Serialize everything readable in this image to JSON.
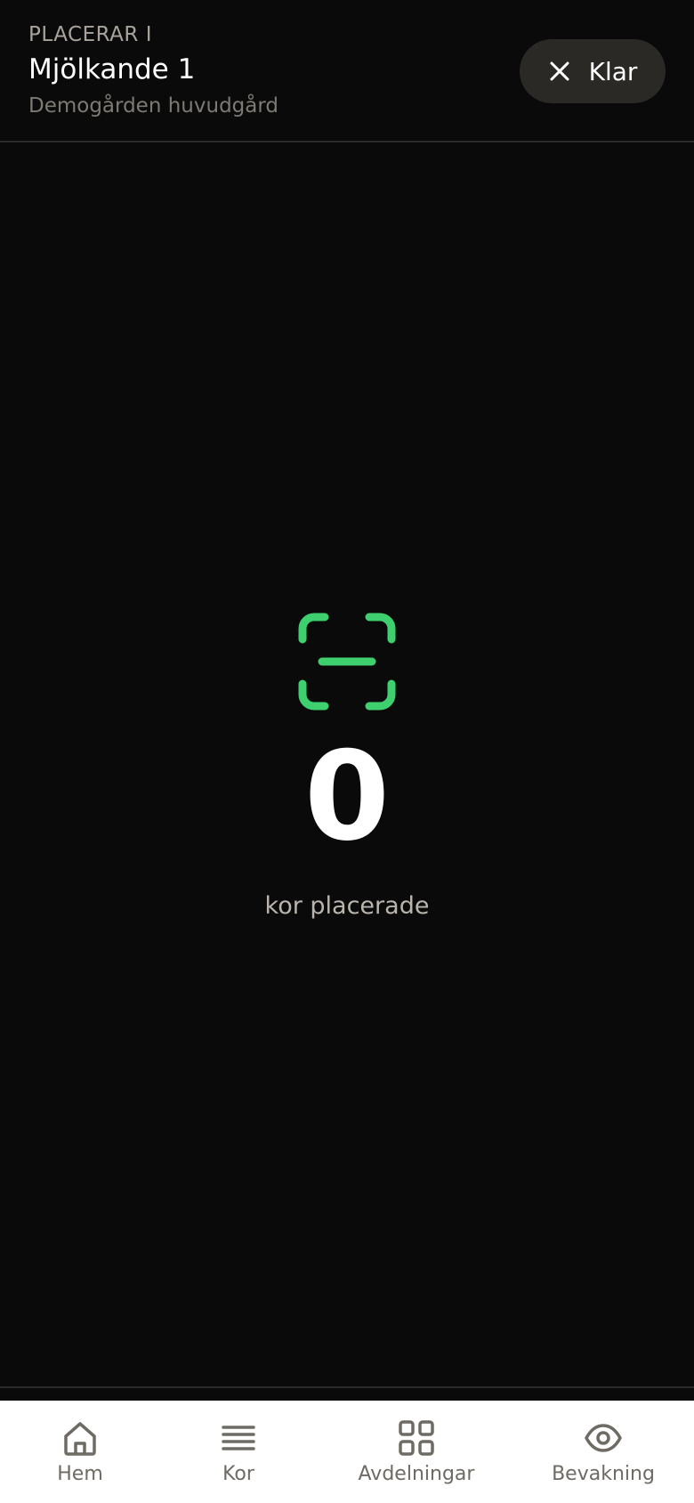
{
  "header": {
    "mode_label": "PLACERAR I",
    "title": "Mjölkande 1",
    "subtitle": "Demogården huvudgård",
    "done_button": {
      "label": "Klar",
      "icon": "close-icon"
    }
  },
  "scanner": {
    "icon": "scan-icon",
    "count": "0",
    "count_label": "kor placerade",
    "accent_color": "#3ecf6e"
  },
  "bottom_nav": {
    "items": [
      {
        "label": "Hem",
        "icon": "home-icon"
      },
      {
        "label": "Kor",
        "icon": "list-icon"
      },
      {
        "label": "Avdelningar",
        "icon": "grid-icon"
      },
      {
        "label": "Bevakning",
        "icon": "eye-icon"
      }
    ]
  },
  "colors": {
    "background": "#0a0a0a",
    "button_bg": "#2b2926",
    "nav_bg": "#ffffff",
    "nav_text": "#6e6a64"
  }
}
